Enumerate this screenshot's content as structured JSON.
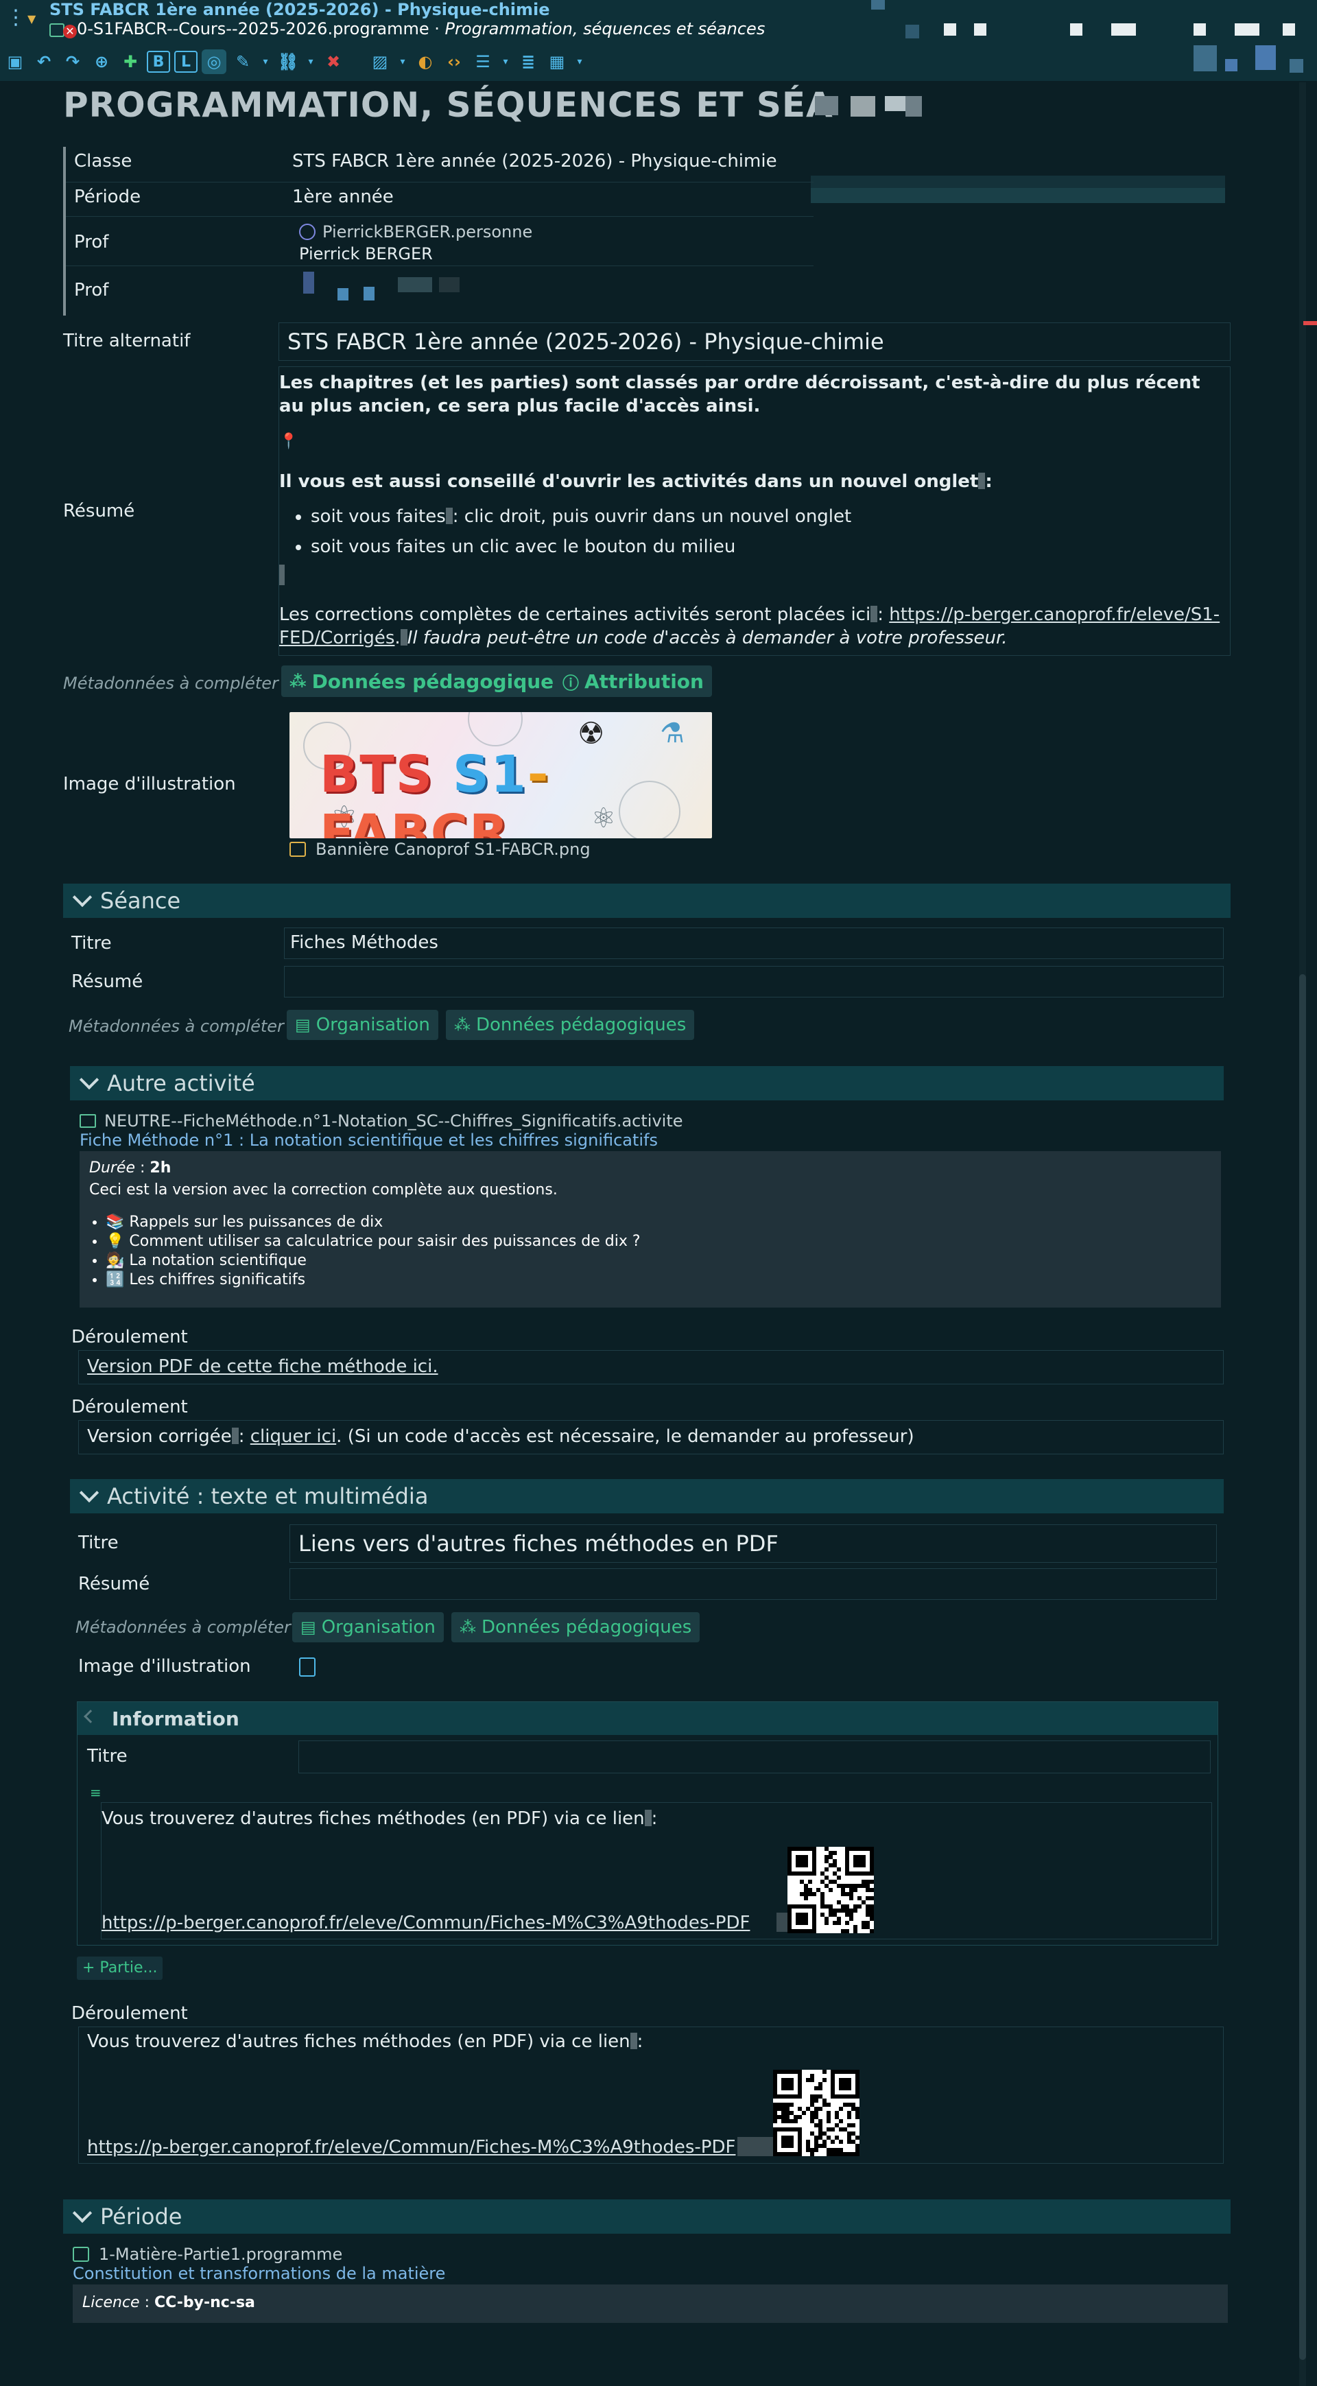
{
  "app": {
    "window_title": "STS FABCR 1ère année (2025-2026) - Physique-chimie",
    "file_name": "0-S1FABCR--Cours--2025-2026.programme",
    "separator": " · ",
    "file_subtitle": "Programmation, séquences et séances"
  },
  "page": {
    "title": "PROGRAMMATION, SÉQUENCES ET SÉA"
  },
  "meta": {
    "rows": [
      {
        "label": "Classe",
        "value": "STS FABCR 1ère année (2025-2026) - Physique-chimie"
      },
      {
        "label": "Période",
        "value": "1ère année"
      },
      {
        "label": "Prof",
        "user_id": "PierrickBERGER.personne",
        "user_name": "Pierrick BERGER"
      },
      {
        "label": "Prof"
      }
    ]
  },
  "fields": {
    "alt_title_label": "Titre alternatif",
    "alt_title_value": "STS FABCR 1ère année (2025-2026) - Physique-chimie",
    "resume_label": "Résumé",
    "resume": {
      "p1": "Les chapitres (et les parties) sont classés par ordre décroissant, c'est-à-dire du plus récent au plus ancien, ce sera plus facile d'accès ainsi.",
      "p2": "Il vous est aussi conseillé d'ouvrir les activités dans un nouvel onglet",
      "p2_end": ":",
      "bullets": [
        "soit vous faites",
        ": clic droit, puis ouvrir dans un nouvel onglet",
        "soit vous faites un clic avec le bouton du milieu"
      ],
      "p3_start": "Les corrections complètes de certaines activités seront placées ici",
      "p3_colon": ": ",
      "p3_link": "https://p-berger.canoprof.fr/eleve/S1-FED/Corrigés",
      "p3_dot": ".",
      "p3_italic": "Il faudra peut-être un code d'accès à demander à votre professeur."
    },
    "metadata_label": "Métadonnées à compléter",
    "btn_pedago": "Données pédagogiques",
    "btn_attribution": "Attribution",
    "image_label": "Image d'illustration",
    "image_caption": "Bannière Canoprof S1-FABCR.png",
    "banner": {
      "w1": "BTS",
      "w2": "S1",
      "dash": "-",
      "w3": "FABCR"
    }
  },
  "seance": {
    "header": "Séance",
    "titre_label": "Titre",
    "titre_value": "Fiches Méthodes",
    "resume_label": "Résumé",
    "metadata_label": "Métadonnées à compléter",
    "btn_org": "Organisation",
    "btn_pedago": "Données pédagogiques"
  },
  "autre_activite": {
    "header": "Autre activité",
    "file": "NEUTRE--FicheMéthode.n°1-Notation_SC--Chiffres_Significatifs.activite",
    "link_title": "Fiche Méthode n°1 : La notation scientifique et les chiffres significatifs",
    "duree_label": "Durée",
    "duree_sep": " : ",
    "duree_value": "2h",
    "desc": "Ceci est la version avec la correction complète aux questions.",
    "items": [
      {
        "icon": "📚",
        "text": "Rappels sur les puissances de dix"
      },
      {
        "icon": "💡",
        "text": "Comment utiliser sa calculatrice pour saisir des puissances de dix ?"
      },
      {
        "icon": "🧑‍🔬",
        "text": "La notation scientifique"
      },
      {
        "icon": "🔢",
        "text": "Les chiffres significatifs"
      }
    ],
    "deroulement1_label": "Déroulement",
    "deroulement1_link": "Version PDF de cette fiche méthode ici.",
    "deroulement2_label": "Déroulement",
    "deroulement2_start": "Version corrigée",
    "deroulement2_colon": ": ",
    "deroulement2_link": "cliquer ici",
    "deroulement2_end": ". (Si un code d'accès est nécessaire, le demander au professeur)"
  },
  "activite_texte": {
    "header": "Activité : texte et multimédia",
    "titre_label": "Titre",
    "titre_value": "Liens vers d'autres fiches méthodes en PDF",
    "resume_label": "Résumé",
    "metadata_label": "Métadonnées à compléter",
    "btn_org": "Organisation",
    "btn_pedago": "Données pédagogiques",
    "image_label": "Image d'illustration",
    "info": {
      "header": "Information",
      "titre_label": "Titre",
      "text": "Vous trouverez d'autres fiches méthodes (en PDF) via ce lien",
      "colon": ":",
      "link": "https://p-berger.canoprof.fr/eleve/Commun/Fiches-M%C3%A9thodes-PDF"
    },
    "add_part": "+ Partie...",
    "deroulement_label": "Déroulement",
    "deroulement_text": "Vous trouverez d'autres fiches méthodes (en PDF) via ce lien",
    "deroulement_colon": ":",
    "deroulement_link": "https://p-berger.canoprof.fr/eleve/Commun/Fiches-M%C3%A9thodes-PDF"
  },
  "periode": {
    "header": "Période",
    "file": "1-Matière-Partie1.programme",
    "link_title": "Constitution et transformations de la matière",
    "licence_label": "Licence",
    "licence_sep": " : ",
    "licence_value": "CC-by-nc-sa"
  }
}
